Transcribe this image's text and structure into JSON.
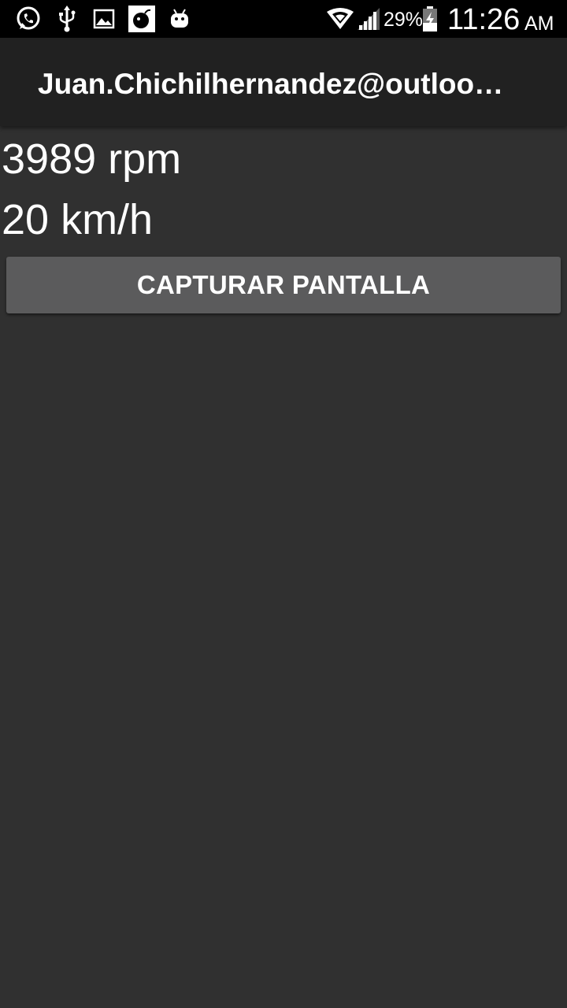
{
  "status_bar": {
    "left_icons": [
      "whatsapp-icon",
      "usb-icon",
      "image-icon",
      "bomb-app-icon",
      "android-icon"
    ],
    "right_icons": [
      "wifi-icon",
      "signal-icon",
      "battery-charging-icon"
    ],
    "battery_percent": "29%",
    "time": "11:26",
    "ampm": "AM"
  },
  "action_bar": {
    "title": "Juan.Chichilhernandez@outlook.com"
  },
  "main": {
    "rpm_text": "3989 rpm",
    "speed_text": "20 km/h",
    "capture_button_label": "CAPTURAR PANTALLA"
  },
  "colors": {
    "background": "#303030",
    "status_bar": "#000000",
    "action_bar": "#212121",
    "button": "#5b5b5c",
    "text": "#ffffff"
  }
}
